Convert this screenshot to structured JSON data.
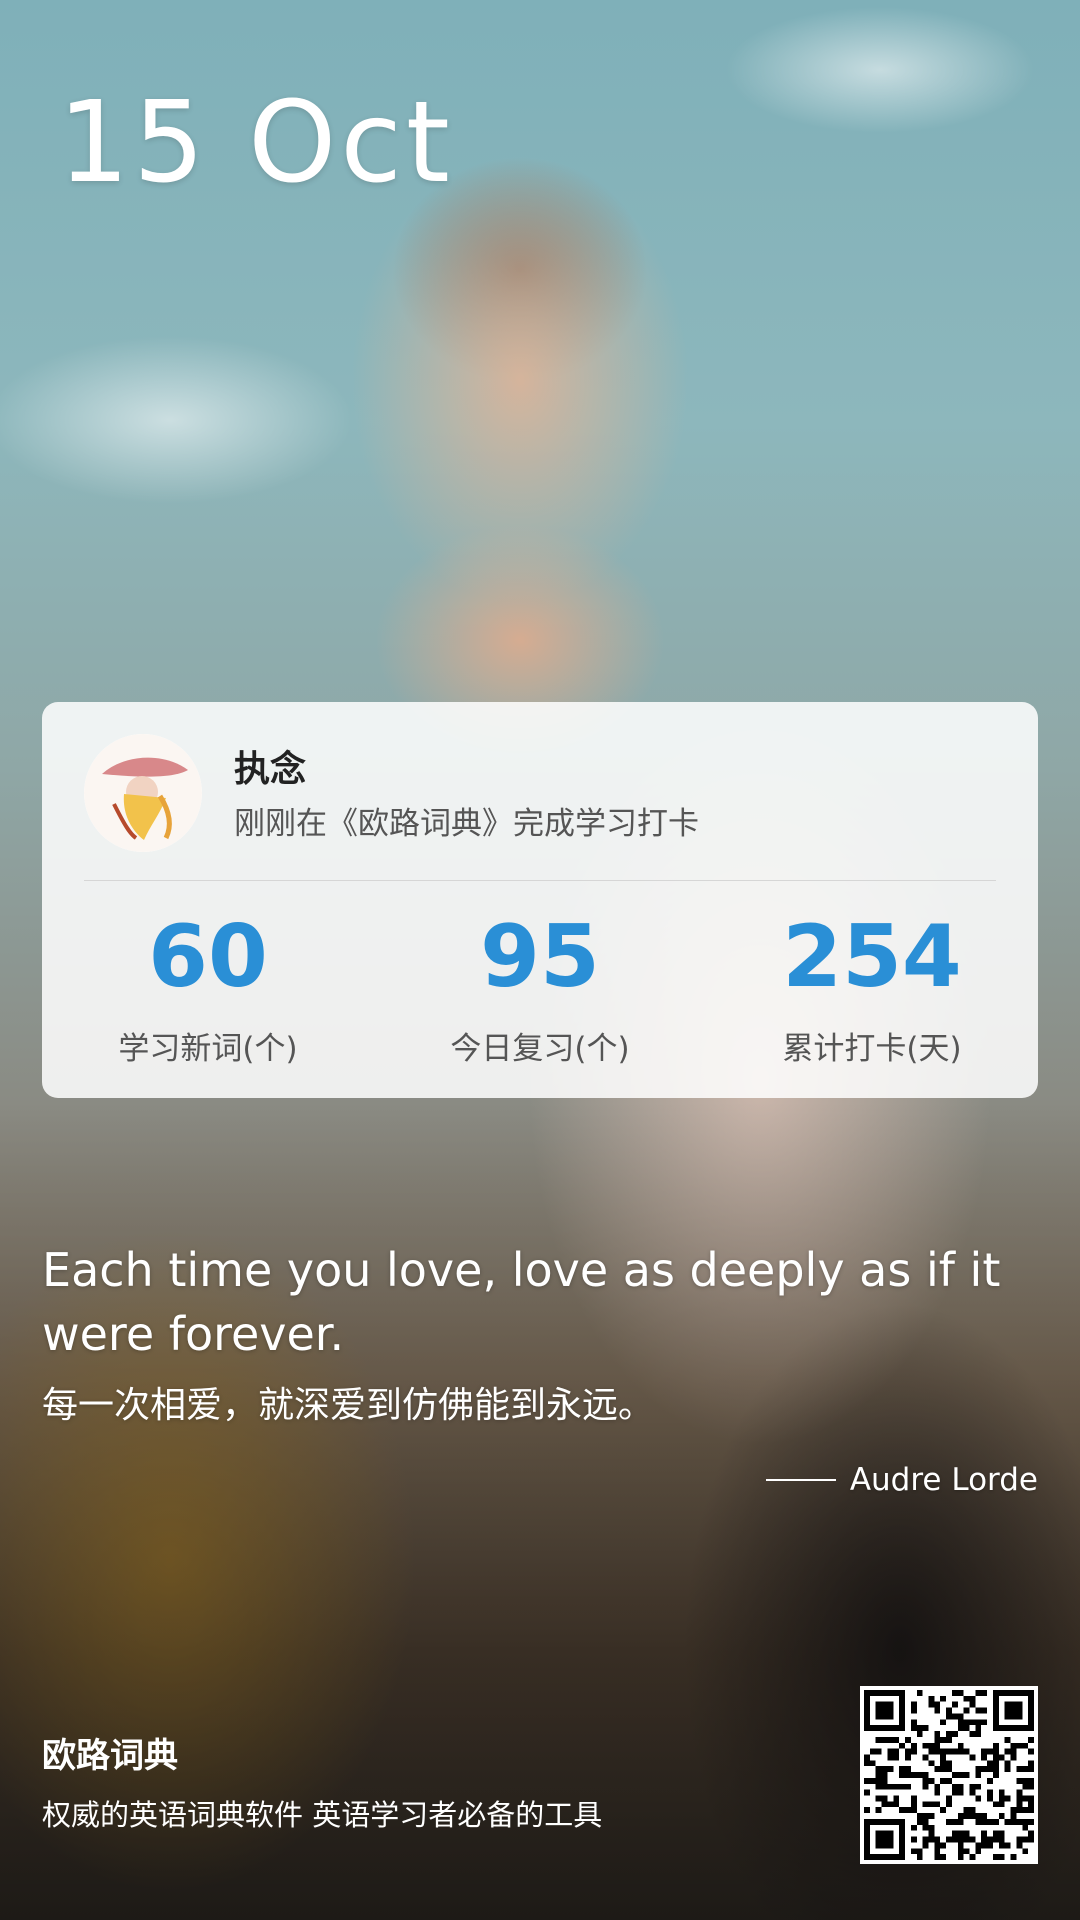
{
  "date": "15 Oct",
  "user": {
    "name": "执念",
    "status": "刚刚在《欧路词典》完成学习打卡"
  },
  "stats": [
    {
      "value": "60",
      "label": "学习新词(个)"
    },
    {
      "value": "95",
      "label": "今日复习(个)"
    },
    {
      "value": "254",
      "label": "累计打卡(天)"
    }
  ],
  "quote": {
    "english": "Each time you love, love as deeply as if it were forever.",
    "chinese": "每一次相爱，就深爱到仿佛能到永远。",
    "author": "Audre Lorde"
  },
  "footer": {
    "app_name": "欧路词典",
    "slogan": "权威的英语词典软件 英语学习者必备的工具"
  },
  "colors": {
    "accent": "#2a8fd6",
    "card_bg": "#ffffff",
    "text_primary": "#222222",
    "text_secondary": "#555555"
  },
  "icons": {
    "avatar": "user-avatar",
    "qr": "qr-code-icon"
  }
}
